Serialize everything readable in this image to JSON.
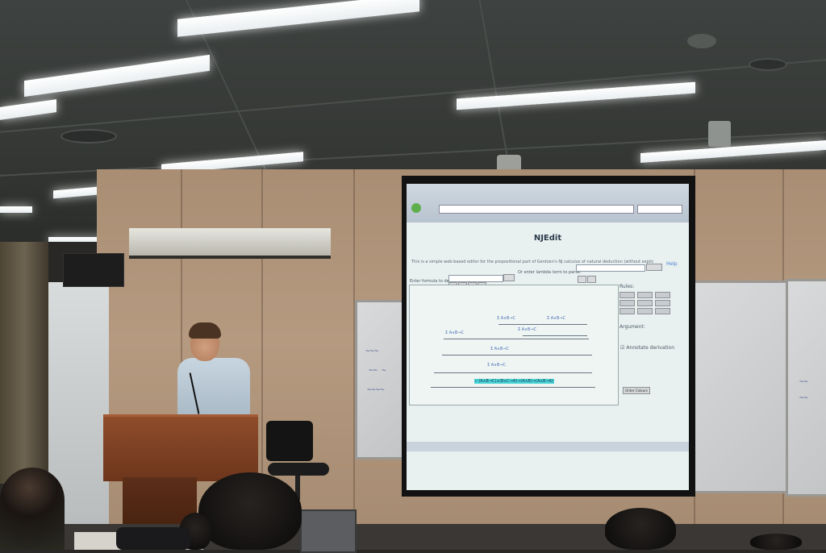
{
  "scene": {
    "description_colors": {
      "ceiling": "#3e4240",
      "wall": "#b59a80",
      "podium": "#8f4c2b",
      "screen": "#e8f0f0"
    }
  },
  "projection": {
    "browser_title": "NJEdit",
    "intro_text": "This is a simple web-based editor for the propositional part of Gentzen's NJ calculus of natural deduction (without explicit rules for negation).",
    "help_link": "Help",
    "enter_formula_label": "Enter formula to derive:",
    "enter_lambda_label": "Or enter lambda term to parse:",
    "rules_label": "Rules:",
    "argument_label": "Argument:",
    "annotate_label": "Annotate derivation",
    "order_button": "Order Colours",
    "highlight_formula": "⊢(A∧B→C)∧(B∧C→A)→(A∧B)→(A∧B→A)"
  }
}
